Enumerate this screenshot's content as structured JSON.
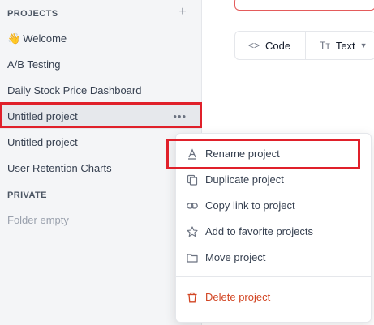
{
  "sidebar": {
    "projects_header": "PROJECTS",
    "add_symbol": "+",
    "items": [
      {
        "emoji": "👋",
        "label": "Welcome"
      },
      {
        "label": "A/B Testing"
      },
      {
        "label": "Daily Stock Price Dashboard"
      },
      {
        "label": "Untitled project",
        "more": "•••"
      },
      {
        "label": "Untitled project"
      },
      {
        "label": "User Retention Charts"
      }
    ],
    "private_header": "PRIVATE",
    "folder_empty": "Folder empty"
  },
  "toolbar": {
    "code_icon": "<>",
    "code_label": "Code",
    "text_icon": "Tт",
    "text_label": "Text"
  },
  "context_menu": {
    "items": [
      {
        "label": "Rename project",
        "icon": "rename-icon"
      },
      {
        "label": "Duplicate project",
        "icon": "duplicate-icon"
      },
      {
        "label": "Copy link to project",
        "icon": "link-icon"
      },
      {
        "label": "Add to favorite projects",
        "icon": "star-icon"
      },
      {
        "label": "Move project",
        "icon": "folder-icon"
      }
    ],
    "delete_label": "Delete project"
  },
  "colors": {
    "highlight": "#e0202a",
    "danger": "#d24523",
    "sidebar_bg": "#f4f5f7"
  }
}
